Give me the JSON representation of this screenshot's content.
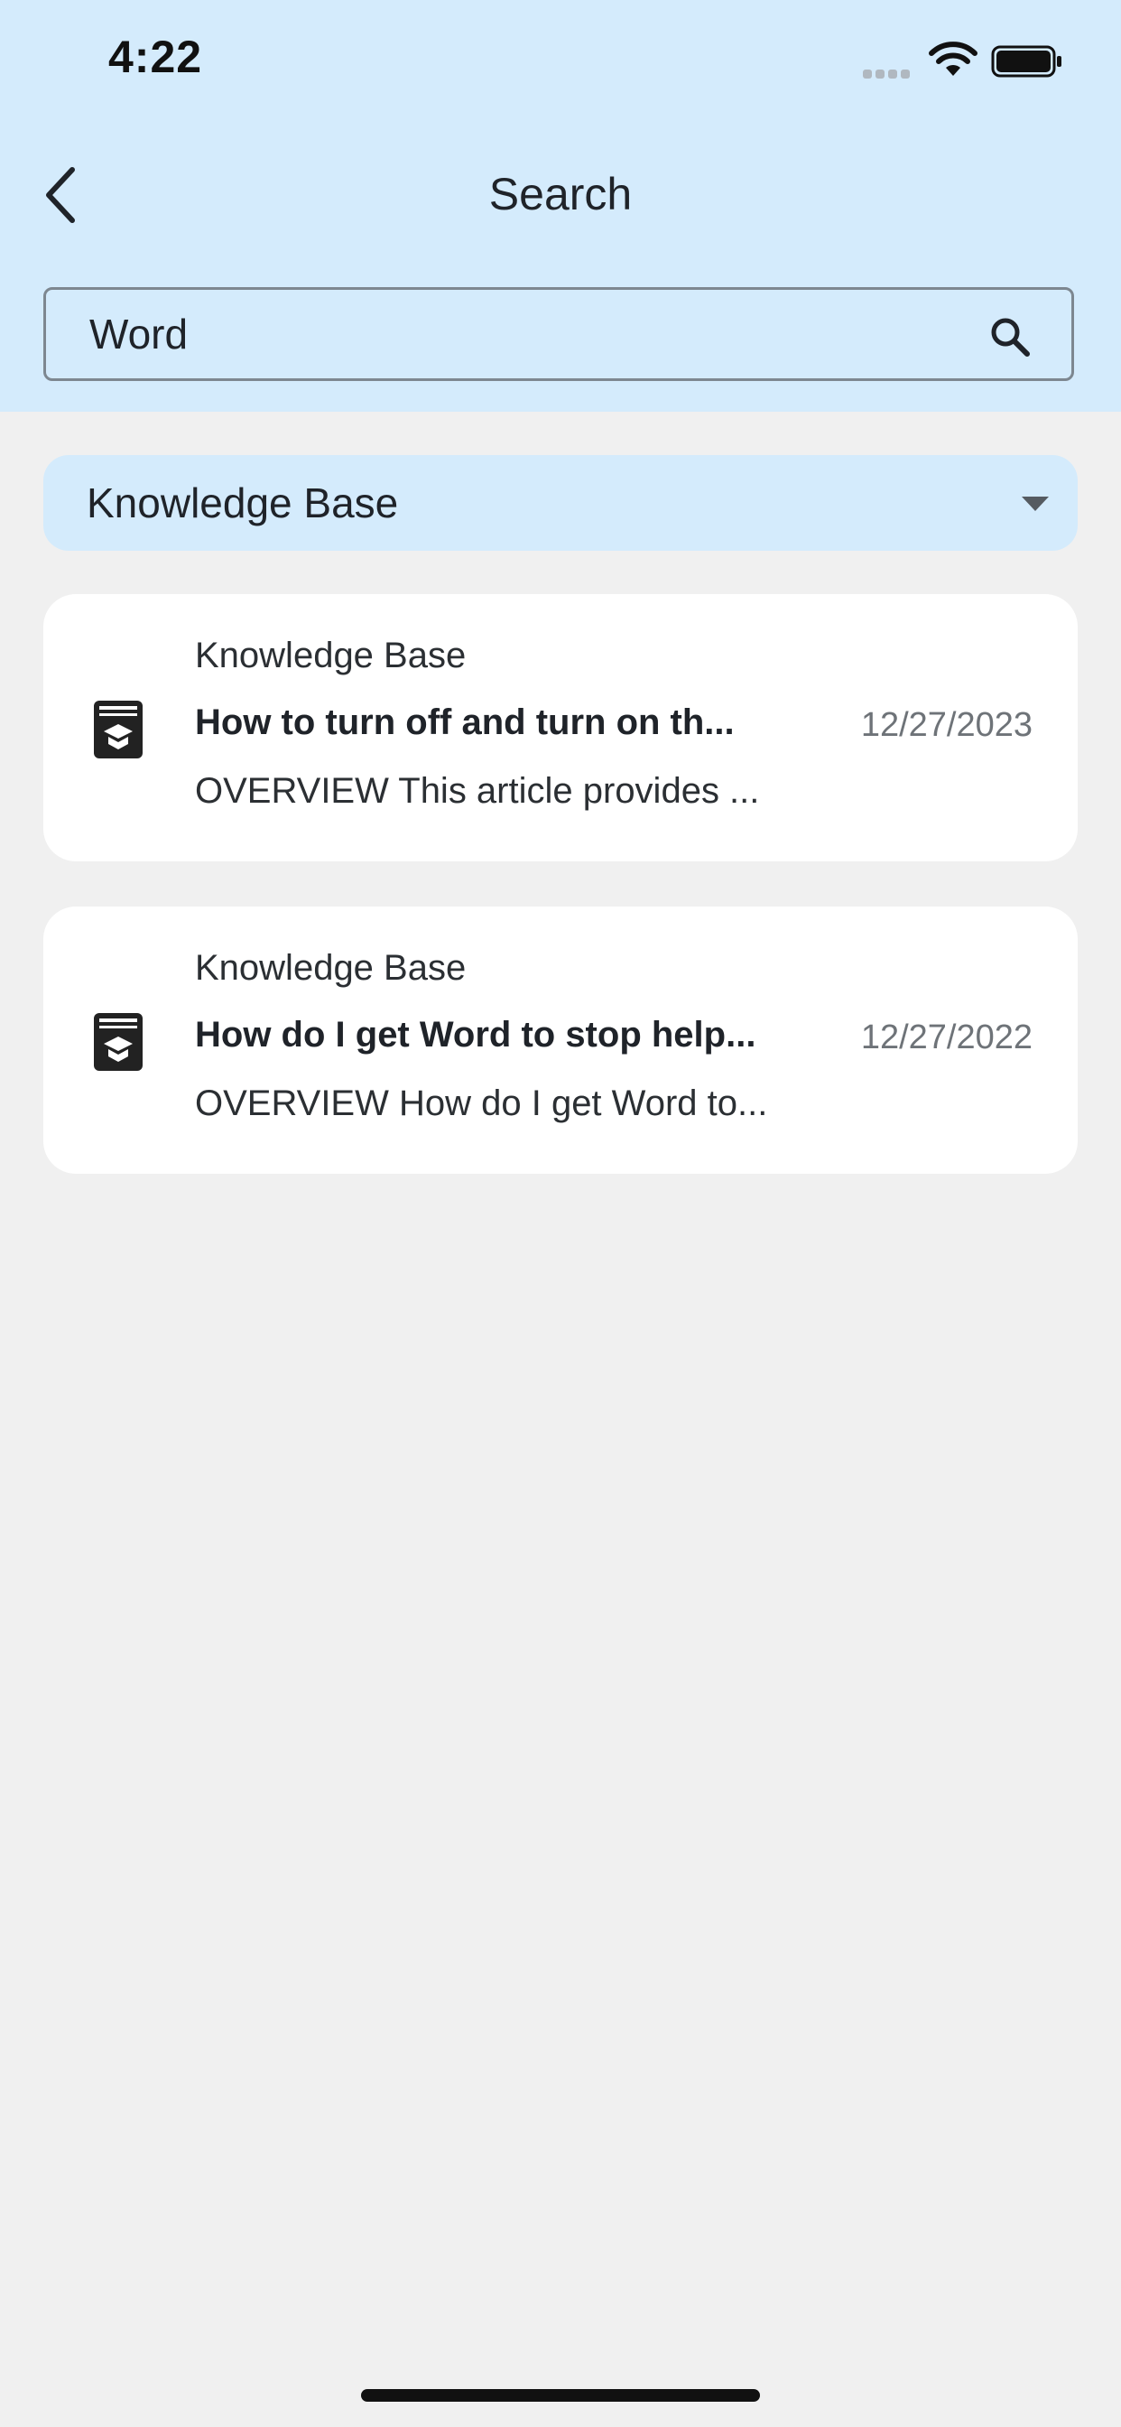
{
  "status_bar": {
    "time": "4:22"
  },
  "header": {
    "title": "Search"
  },
  "search": {
    "value": "Word",
    "placeholder": ""
  },
  "filter": {
    "selected": "Knowledge Base"
  },
  "results": [
    {
      "source": "Knowledge Base",
      "title": "How to turn off and turn on th...",
      "date": "12/27/2023",
      "snippet": "OVERVIEW This article provides ...",
      "icon": "knowledge-book-icon"
    },
    {
      "source": "Knowledge Base",
      "title": "How do I get Word to stop help...",
      "date": "12/27/2022",
      "snippet": "OVERVIEW How do I get Word to...",
      "icon": "knowledge-book-icon"
    }
  ],
  "colors": {
    "header_bg": "#d4ebfc",
    "page_bg": "#f0f0f0",
    "card_bg": "#ffffff",
    "date_text": "#6e7378"
  }
}
